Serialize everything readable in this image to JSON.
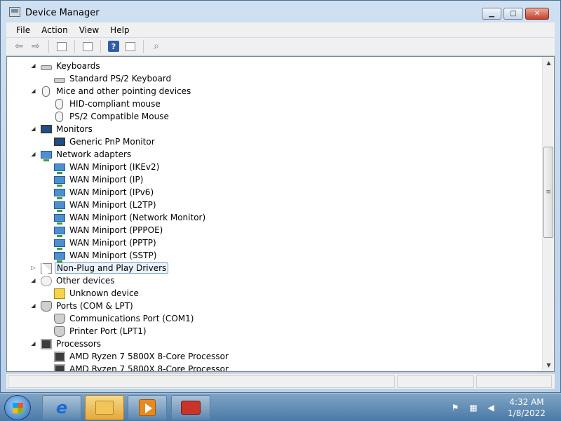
{
  "window": {
    "title": "Device Manager"
  },
  "menu": [
    "File",
    "Action",
    "View",
    "Help"
  ],
  "tree": [
    {
      "level": 0,
      "expander": "expanded",
      "icon": "keyboard-icon",
      "label": "Keyboards"
    },
    {
      "level": 1,
      "expander": "none",
      "icon": "keyboard-icon",
      "label": "Standard PS/2 Keyboard"
    },
    {
      "level": 0,
      "expander": "expanded",
      "icon": "mouse-icon",
      "label": "Mice and other pointing devices"
    },
    {
      "level": 1,
      "expander": "none",
      "icon": "mouse-icon",
      "label": "HID-compliant mouse"
    },
    {
      "level": 1,
      "expander": "none",
      "icon": "mouse-icon",
      "label": "PS/2 Compatible Mouse"
    },
    {
      "level": 0,
      "expander": "expanded",
      "icon": "monitor-icon",
      "label": "Monitors"
    },
    {
      "level": 1,
      "expander": "none",
      "icon": "monitor-icon",
      "label": "Generic PnP Monitor"
    },
    {
      "level": 0,
      "expander": "expanded",
      "icon": "network-adapter-icon",
      "label": "Network adapters"
    },
    {
      "level": 1,
      "expander": "none",
      "icon": "network-adapter-icon",
      "label": "WAN Miniport (IKEv2)"
    },
    {
      "level": 1,
      "expander": "none",
      "icon": "network-adapter-icon",
      "label": "WAN Miniport (IP)"
    },
    {
      "level": 1,
      "expander": "none",
      "icon": "network-adapter-icon",
      "label": "WAN Miniport (IPv6)"
    },
    {
      "level": 1,
      "expander": "none",
      "icon": "network-adapter-icon",
      "label": "WAN Miniport (L2TP)"
    },
    {
      "level": 1,
      "expander": "none",
      "icon": "network-adapter-icon",
      "label": "WAN Miniport (Network Monitor)"
    },
    {
      "level": 1,
      "expander": "none",
      "icon": "network-adapter-icon",
      "label": "WAN Miniport (PPPOE)"
    },
    {
      "level": 1,
      "expander": "none",
      "icon": "network-adapter-icon",
      "label": "WAN Miniport (PPTP)"
    },
    {
      "level": 1,
      "expander": "none",
      "icon": "network-adapter-icon",
      "label": "WAN Miniport (SSTP)"
    },
    {
      "level": 0,
      "expander": "collapsed",
      "icon": "generic-device-icon",
      "label": "Non-Plug and Play Drivers",
      "selected": true
    },
    {
      "level": 0,
      "expander": "expanded",
      "icon": "other-devices-icon",
      "label": "Other devices"
    },
    {
      "level": 1,
      "expander": "none",
      "icon": "unknown-device-warning-icon",
      "label": "Unknown device"
    },
    {
      "level": 0,
      "expander": "expanded",
      "icon": "port-icon",
      "label": "Ports (COM & LPT)"
    },
    {
      "level": 1,
      "expander": "none",
      "icon": "port-icon",
      "label": "Communications Port (COM1)"
    },
    {
      "level": 1,
      "expander": "none",
      "icon": "port-icon",
      "label": "Printer Port (LPT1)"
    },
    {
      "level": 0,
      "expander": "expanded",
      "icon": "processor-icon",
      "label": "Processors"
    },
    {
      "level": 1,
      "expander": "none",
      "icon": "processor-icon",
      "label": "AMD Ryzen 7 5800X 8-Core Processor"
    },
    {
      "level": 1,
      "expander": "none",
      "icon": "processor-icon",
      "label": "AMD Ryzen 7 5800X 8-Core Processor"
    }
  ],
  "taskbar": {
    "apps": [
      "internet-explorer-icon",
      "windows-explorer-icon",
      "media-player-icon",
      "toolbox-icon"
    ],
    "clock": {
      "time": "4:32 AM",
      "date": "1/8/2022"
    }
  }
}
